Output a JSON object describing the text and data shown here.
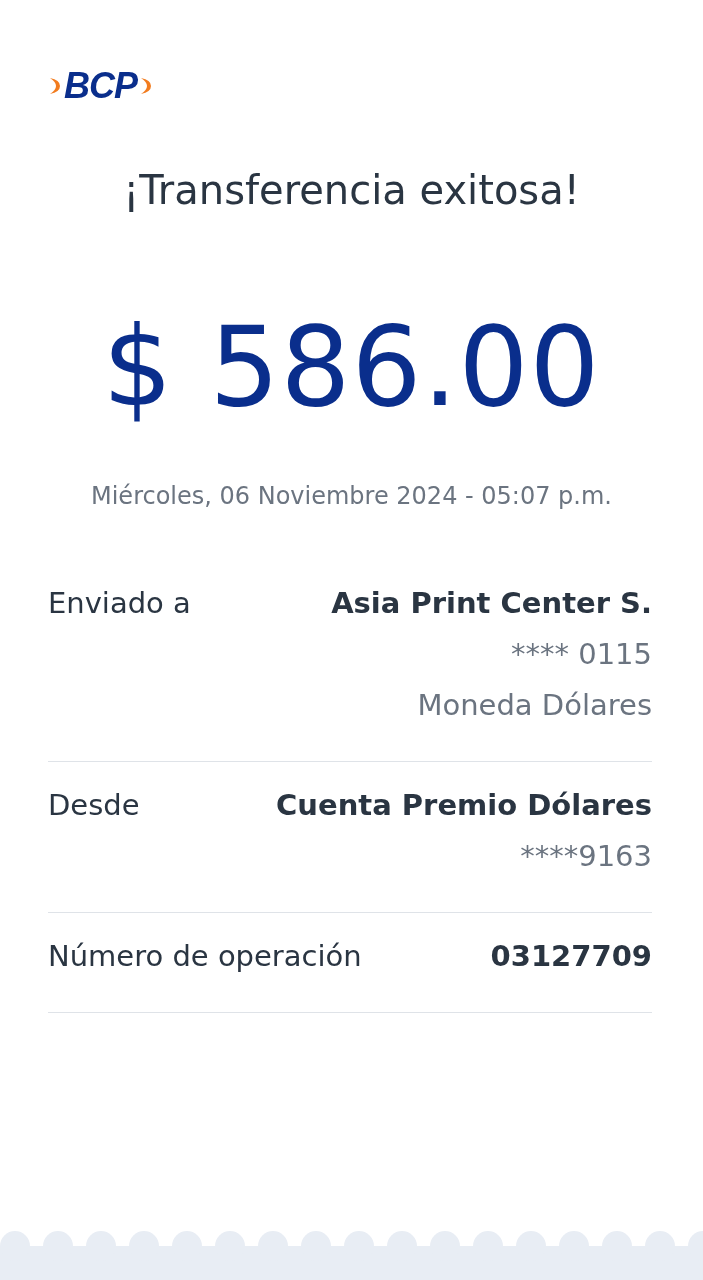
{
  "logo": {
    "text": "BCP"
  },
  "title": "¡Transferencia exitosa!",
  "amount": "$ 586.00",
  "date": "Miércoles, 06 Noviembre 2024 - 05:07 p.m.",
  "details": [
    {
      "label": "Enviado a",
      "values": [
        "Asia Print Center S.",
        "**** 0115",
        "Moneda Dólares"
      ]
    },
    {
      "label": "Desde",
      "values": [
        "Cuenta Premio Dólares",
        "****9163"
      ]
    },
    {
      "label": "Número de operación",
      "values": [
        "03127709"
      ]
    }
  ]
}
